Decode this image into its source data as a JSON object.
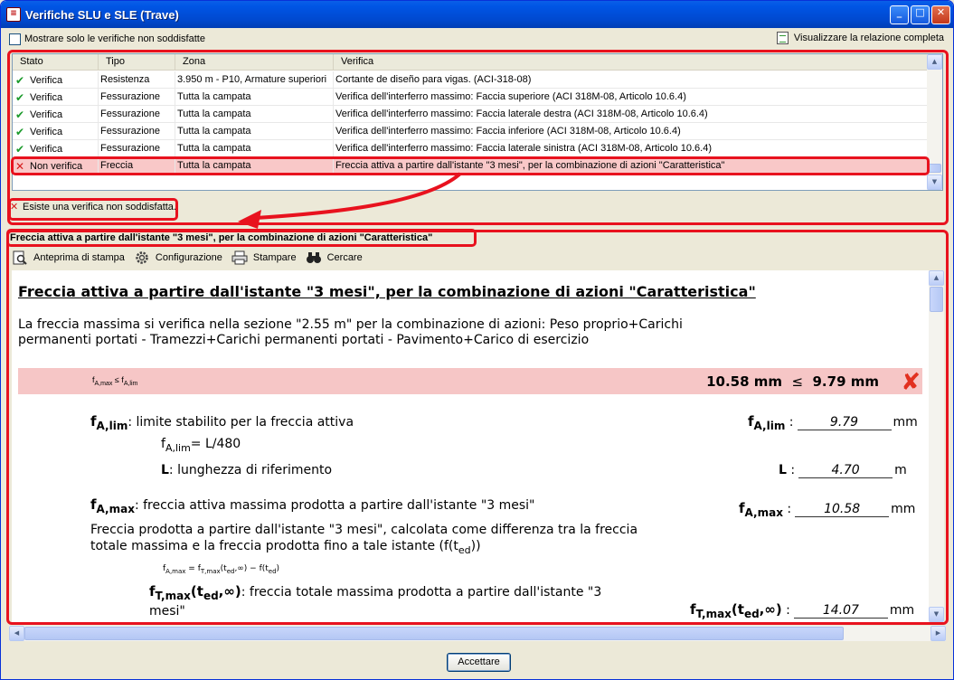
{
  "window": {
    "title": "Verifiche SLU e SLE (Trave)"
  },
  "filter": {
    "label": "Mostrare solo le verifiche non soddisfatte"
  },
  "view_report": {
    "label": "Visualizzare la relazione completa"
  },
  "table": {
    "headers": [
      "Stato",
      "Tipo",
      "Zona",
      "Verifica"
    ],
    "rows": [
      {
        "stato": "Verifica",
        "tipo": "Resistenza",
        "zona": "3.950 m - P10, Armature superiori",
        "verifica": "Cortante de diseño para vigas. (ACI-318-08)"
      },
      {
        "stato": "Verifica",
        "tipo": "Fessurazione",
        "zona": "Tutta la campata",
        "verifica": "Verifica dell'interferro massimo: Faccia superiore (ACI 318M-08, Articolo 10.6.4)"
      },
      {
        "stato": "Verifica",
        "tipo": "Fessurazione",
        "zona": "Tutta la campata",
        "verifica": "Verifica dell'interferro massimo: Faccia laterale destra (ACI 318M-08, Articolo 10.6.4)"
      },
      {
        "stato": "Verifica",
        "tipo": "Fessurazione",
        "zona": "Tutta la campata",
        "verifica": "Verifica dell'interferro massimo: Faccia inferiore (ACI 318M-08, Articolo 10.6.4)"
      },
      {
        "stato": "Verifica",
        "tipo": "Fessurazione",
        "zona": "Tutta la campata",
        "verifica": "Verifica dell'interferro massimo: Faccia laterale sinistra (ACI 318M-08, Articolo 10.6.4)"
      },
      {
        "stato": "Non verifica",
        "tipo": "Freccia",
        "zona": "Tutta la campata",
        "verifica": "Freccia attiva a partire dall'istante \"3 mesi\", per la combinazione di azioni \"Caratteristica\""
      }
    ]
  },
  "status": {
    "text": "Esiste una verifica non soddisfatta."
  },
  "section": {
    "header": "Freccia attiva a partire dall'istante \"3 mesi\", per la combinazione di azioni \"Caratteristica\""
  },
  "toolbar": {
    "preview": "Anteprima di stampa",
    "config": "Configurazione",
    "print": "Stampare",
    "search": "Cercare"
  },
  "report": {
    "title": "Freccia attiva a partire dall'istante \"3 mesi\", per la combinazione di azioni \"Caratteristica\"",
    "para": "La freccia massima si verifica nella sezione \"2.55 m\" per la combinazione di azioni: Peso proprio+Carichi permanenti portati - Tramezzi+Carichi permanenti portati - Pavimento+Carico di esercizio",
    "check": {
      "lhs": "10.58 mm",
      "op": "≤",
      "rhs": "9.79 mm"
    },
    "flim_desc": ": limite stabilito per la freccia attiva",
    "flim_formula": "= L/480",
    "L_desc": ": lunghezza di riferimento",
    "fmax_desc": ": freccia attiva massima prodotta a partire dall'istante \"3 mesi\"",
    "fmax_para": "Freccia prodotta a partire dall'istante \"3 mesi\", calcolata come differenza tra la freccia totale massima e la freccia prodotta fino a tale istante (f(t",
    "ftmax_desc": ": freccia totale massima prodotta a partire dall'istante \"3",
    "ftmax_desc2": "mesi\"",
    "values": {
      "flim": "9.79",
      "L": "4.70",
      "fmax": "10.58",
      "ftmax": "14.07"
    },
    "units": {
      "mm": "mm",
      "m": "m"
    }
  },
  "buttons": {
    "ok": "Accettare"
  }
}
